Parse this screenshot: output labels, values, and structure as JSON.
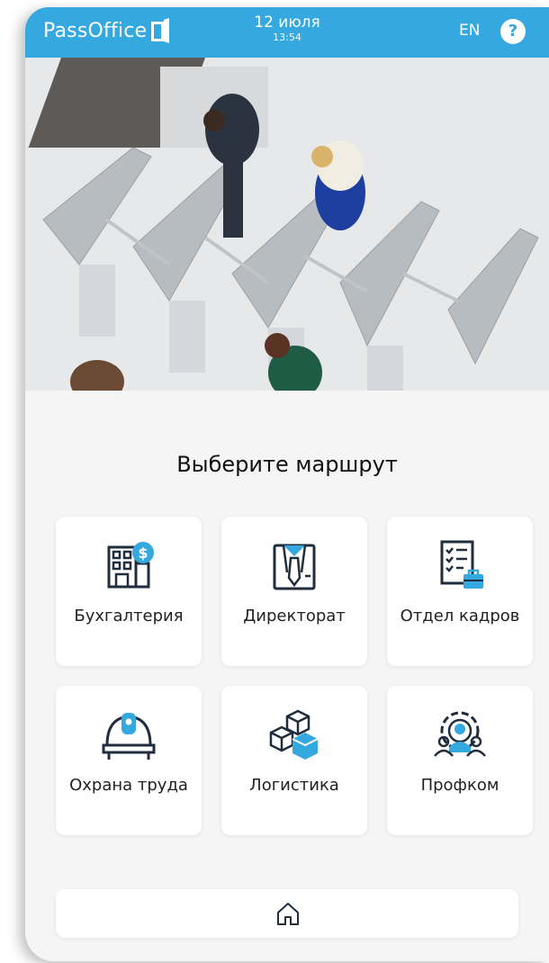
{
  "header": {
    "logo": "PassOffice",
    "date": "12 июля",
    "time": "13:54",
    "lang": "EN",
    "help": "?"
  },
  "main": {
    "title": "Выберите маршрут",
    "routes": [
      {
        "label": "Бухгалтерия",
        "icon": "accounting-building-icon"
      },
      {
        "label": "Директорат",
        "icon": "director-suit-icon"
      },
      {
        "label": "Отдел кадров",
        "icon": "hr-checklist-icon"
      },
      {
        "label": "Охрана труда",
        "icon": "safety-helmet-icon"
      },
      {
        "label": "Логистика",
        "icon": "logistics-boxes-icon"
      },
      {
        "label": "Профком",
        "icon": "union-gear-icon"
      }
    ]
  },
  "footer": {
    "home_icon": "home-icon"
  },
  "colors": {
    "accent": "#35a8e0",
    "dark": "#1f2d3d",
    "background": "#f5f5f5"
  }
}
